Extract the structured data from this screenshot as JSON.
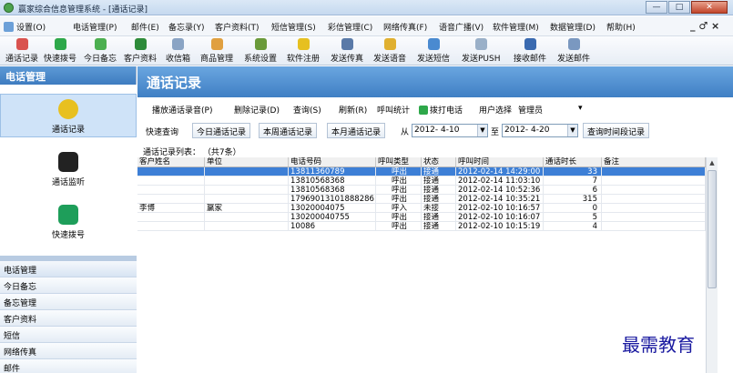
{
  "window": {
    "title": "赢家综合信息管理系统 - [通话记录]",
    "minimize": "—",
    "maximize": "□",
    "close": "✕"
  },
  "menu": {
    "items": [
      {
        "label": "设置(O)",
        "icon": "gear-icon"
      },
      {
        "label": "电话管理(P)"
      },
      {
        "label": "邮件(E)"
      },
      {
        "label": "备忘录(Y)"
      },
      {
        "label": "客户资料(T)"
      },
      {
        "label": "短信管理(S)"
      },
      {
        "label": "彩信管理(C)"
      },
      {
        "label": "网络传真(F)"
      },
      {
        "label": "语音广播(V)"
      },
      {
        "label": "软件管理(M)"
      },
      {
        "label": "数据管理(D)"
      },
      {
        "label": "帮助(H)"
      }
    ],
    "mdi_controls": "_ ♂ ×"
  },
  "toolbar": {
    "items": [
      {
        "label": "通话记录",
        "icon": "phone-record-icon",
        "color": "#d9534f"
      },
      {
        "label": "快速拨号",
        "icon": "quick-dial-icon",
        "color": "#2ea84a"
      },
      {
        "label": "今日备忘",
        "icon": "memo-icon",
        "color": "#4caf50"
      },
      {
        "label": "客户资料",
        "icon": "customer-icon",
        "color": "#2e8b3a"
      },
      {
        "label": "收信箱",
        "icon": "inbox-icon",
        "color": "#8aa4c4"
      },
      {
        "label": "商品管理",
        "icon": "goods-icon",
        "color": "#e0a040"
      },
      {
        "label": "系统设置",
        "icon": "settings-icon",
        "color": "#6a9a3a"
      },
      {
        "label": "软件注册",
        "icon": "register-icon",
        "color": "#e6c020"
      },
      {
        "label": "发送传真",
        "icon": "fax-icon",
        "color": "#5a7aa8"
      },
      {
        "label": "发送语音",
        "icon": "voice-icon",
        "color": "#e0b030"
      },
      {
        "label": "发送短信",
        "icon": "sms-icon",
        "color": "#4a8ad0"
      },
      {
        "label": "发送PUSH",
        "icon": "push-icon",
        "color": "#9ab0c8"
      },
      {
        "label": "接收邮件",
        "icon": "receive-mail-icon",
        "color": "#3a6ab0"
      },
      {
        "label": "发送邮件",
        "icon": "send-mail-icon",
        "color": "#7a98c0"
      }
    ]
  },
  "sidebar": {
    "header": "电话管理",
    "big_items": [
      {
        "label": "通话记录",
        "icon": "call-record-icon",
        "color": "#e8c020",
        "selected": true
      },
      {
        "label": "通话监听",
        "icon": "headset-icon",
        "color": "#222222",
        "selected": false
      },
      {
        "label": "快速拨号",
        "icon": "dial-phone-icon",
        "color": "#1e9e5a",
        "selected": false
      }
    ],
    "nav": [
      "电话管理",
      "今日备忘",
      "备忘管理",
      "客户资料",
      "短信",
      "网络传真",
      "邮件"
    ]
  },
  "main": {
    "header": "通话记录",
    "actions": {
      "play": "播放通话录音(P)",
      "delete": "删除记录(D)",
      "query": "查询(S)",
      "refresh": "刷新(R)",
      "stats": "呼叫统计",
      "dial": "拨打电话",
      "user_select_label": "用户选择",
      "user_select_value": "管理员"
    },
    "query": {
      "quick": "快速查询",
      "today": "今日通话记录",
      "week": "本周通话记录",
      "month": "本月通话记录",
      "from_label": "从",
      "from_date": "2012- 4-10",
      "to_label": "至",
      "to_date": "2012- 4-20",
      "range_btn": "查询时间段记录"
    },
    "list_title": "通话记录列表：  （共7条）",
    "columns": [
      "客户姓名",
      "单位",
      "电话号码",
      "呼叫类型",
      "状态",
      "呼叫时间",
      "通话时长",
      "备注"
    ],
    "rows": [
      [
        "",
        "",
        "13811360789",
        "呼出",
        "接通",
        "2012-02-14 14:29:00",
        "33",
        ""
      ],
      [
        "",
        "",
        "13810568368",
        "呼出",
        "接通",
        "2012-02-14 11:03:10",
        "7",
        ""
      ],
      [
        "",
        "",
        "13810568368",
        "呼出",
        "接通",
        "2012-02-14 10:52:36",
        "6",
        ""
      ],
      [
        "",
        "",
        "17969013101888286",
        "呼出",
        "接通",
        "2012-02-14 10:35:21",
        "315",
        ""
      ],
      [
        "李博",
        "赢家",
        "13020004075",
        "呼入",
        "未接",
        "2012-02-10 10:16:57",
        "0",
        ""
      ],
      [
        "",
        "",
        "130200040755",
        "呼出",
        "接通",
        "2012-02-10 10:16:07",
        "5",
        ""
      ],
      [
        "",
        "",
        "10086",
        "呼出",
        "接通",
        "2012-02-10 10:15:19",
        "4",
        ""
      ]
    ],
    "selected_row": 0
  },
  "watermark": "最需教育"
}
